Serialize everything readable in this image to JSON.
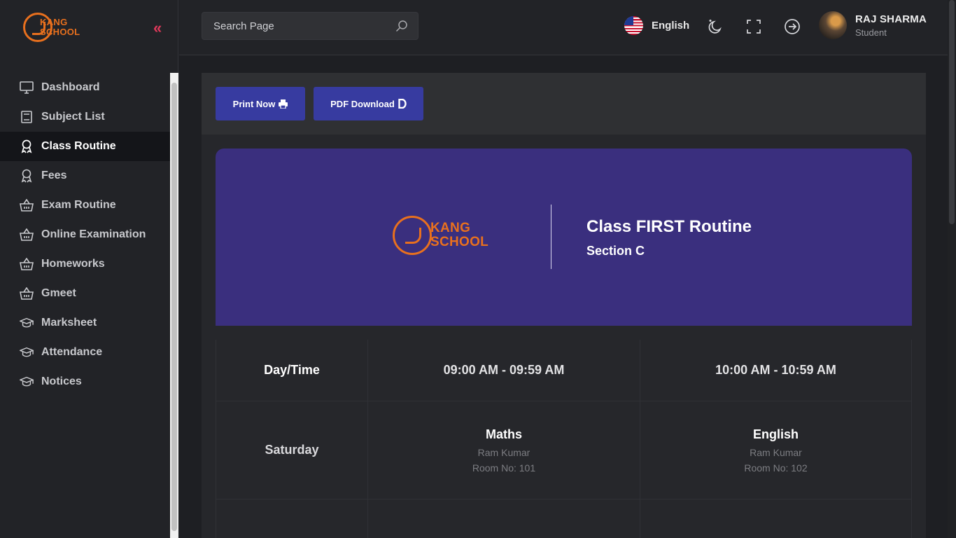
{
  "brand": {
    "line1": "KANG",
    "line2": "SCHOOL"
  },
  "sidebar": {
    "items": [
      {
        "label": "Dashboard",
        "icon": "monitor-icon",
        "active": false
      },
      {
        "label": "Subject List",
        "icon": "book-icon",
        "active": false
      },
      {
        "label": "Class Routine",
        "icon": "award-icon",
        "active": true
      },
      {
        "label": "Fees",
        "icon": "award-icon",
        "active": false
      },
      {
        "label": "Exam Routine",
        "icon": "basket-icon",
        "active": false
      },
      {
        "label": "Online Examination",
        "icon": "basket-icon",
        "active": false
      },
      {
        "label": "Homeworks",
        "icon": "basket-icon",
        "active": false
      },
      {
        "label": "Gmeet",
        "icon": "basket-icon",
        "active": false
      },
      {
        "label": "Marksheet",
        "icon": "graduation-cap-icon",
        "active": false
      },
      {
        "label": "Attendance",
        "icon": "graduation-cap-icon",
        "active": false
      },
      {
        "label": "Notices",
        "icon": "graduation-cap-icon",
        "active": false
      }
    ]
  },
  "topbar": {
    "search_placeholder": "Search Page",
    "language": "English",
    "user": {
      "name": "RAJ SHARMA",
      "role": "Student"
    }
  },
  "actions": {
    "print_label": "Print Now",
    "pdf_label": "PDF Download"
  },
  "routine": {
    "title": "Class FIRST Routine",
    "section": "Section C",
    "header": {
      "day_time": "Day/Time",
      "slots": [
        "09:00 AM - 09:59 AM",
        "10:00 AM - 10:59 AM"
      ]
    },
    "rows": [
      {
        "day": "Saturday",
        "slots": [
          {
            "subject": "Maths",
            "teacher": "Ram Kumar",
            "room": "Room No: 101"
          },
          {
            "subject": "English",
            "teacher": "Ram Kumar",
            "room": "Room No: 102"
          }
        ]
      }
    ]
  },
  "colors": {
    "accent": "#373ba0",
    "banner": "#3a2f7e",
    "brand": "#e8701e",
    "collapse": "#e0395b"
  }
}
